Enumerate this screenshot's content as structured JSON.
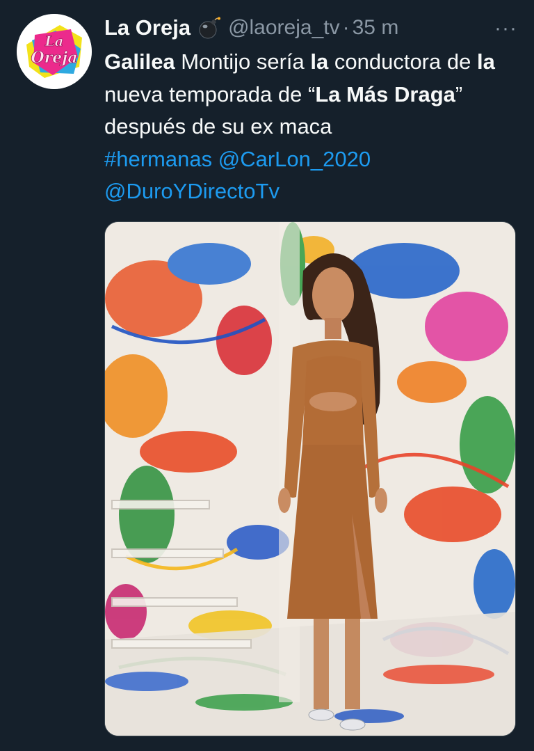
{
  "author": {
    "avatar_text": "La Oreja",
    "display_name": "La Oreja",
    "badge_icon": "bomb-icon",
    "handle": "@laoreja_tv",
    "separator": "·",
    "time": "35 m",
    "more_icon": "···"
  },
  "tweet": {
    "segments": [
      {
        "t": "Galilea",
        "b": true
      },
      {
        "t": " Montijo sería ",
        "b": false
      },
      {
        "t": "la",
        "b": true
      },
      {
        "t": " conductora de ",
        "b": false
      },
      {
        "t": "la",
        "b": true
      },
      {
        "t": " nueva temporada de “",
        "b": false
      },
      {
        "t": "La Más Draga",
        "b": true
      },
      {
        "t": "” después de su ex maca",
        "b": false
      }
    ],
    "hashtag": "#hermanas",
    "mention_1": "@CarLon_2020",
    "mention_2": "@DuroYDirectoTv"
  },
  "media": {
    "icon": "photo",
    "subject": "woman in brown cut-out midi dress on paint-splattered set"
  },
  "colors": {
    "background": "#15202b",
    "text": "#f7f9f9",
    "secondary": "#8b98a5",
    "link": "#1d9bf0",
    "dress": "#b5703a"
  }
}
